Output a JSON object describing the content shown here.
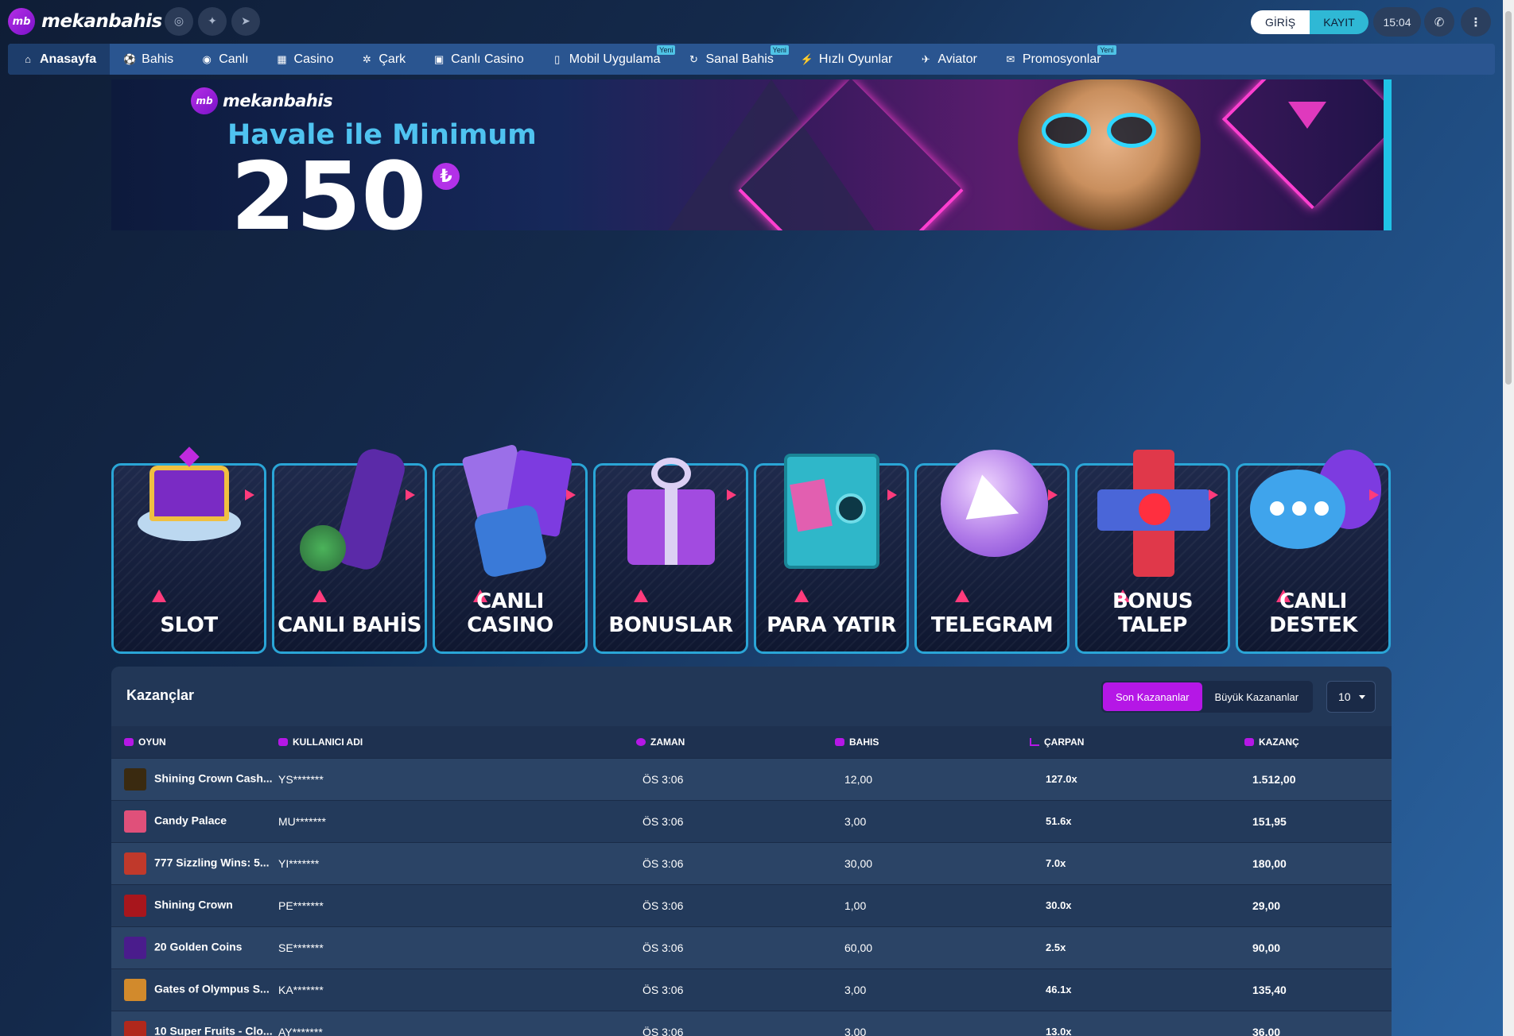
{
  "brand": {
    "logo_text": "mekanbahis",
    "logo_badge": "mb"
  },
  "header": {
    "social": [
      {
        "icon": "instagram-icon",
        "glyph": "◎"
      },
      {
        "icon": "twitter-icon",
        "glyph": "✦"
      },
      {
        "icon": "telegram-icon",
        "glyph": "➤"
      }
    ],
    "login_label": "GİRİŞ",
    "register_label": "KAYIT",
    "time": "15:04"
  },
  "nav": [
    {
      "label": "Anasayfa",
      "icon": "home-icon",
      "glyph": "⌂",
      "active": true
    },
    {
      "label": "Bahis",
      "icon": "soccer-ball-icon",
      "glyph": "⚽"
    },
    {
      "label": "Canlı",
      "icon": "live-icon",
      "glyph": "◉"
    },
    {
      "label": "Casino",
      "icon": "casino-icon",
      "glyph": "▦"
    },
    {
      "label": "Çark",
      "icon": "wheel-icon",
      "glyph": "✲"
    },
    {
      "label": "Canlı Casino",
      "icon": "live-casino-icon",
      "glyph": "▣"
    },
    {
      "label": "Mobil Uygulama",
      "icon": "mobile-icon",
      "glyph": "▯",
      "badge": "Yeni"
    },
    {
      "label": "Sanal Bahis",
      "icon": "virtual-icon",
      "glyph": "↻",
      "badge": "Yeni"
    },
    {
      "label": "Hızlı Oyunlar",
      "icon": "fast-games-icon",
      "glyph": "⚡"
    },
    {
      "label": "Aviator",
      "icon": "rocket-icon",
      "glyph": "✈"
    },
    {
      "label": "Promosyonlar",
      "icon": "gift-icon",
      "glyph": "✉",
      "badge": "Yeni"
    }
  ],
  "banner": {
    "logo_text": "mekanbahis",
    "headline": "Havale ile Minimum",
    "amount": "250",
    "currency_symbol": "₺"
  },
  "tiles": [
    {
      "label": "SLOT",
      "icon": "crown-icon"
    },
    {
      "label": "CANLI BAHİS",
      "icon": "football-player-icon"
    },
    {
      "label": "CANLI CASINO",
      "icon": "cards-dice-icon"
    },
    {
      "label": "BONUSLAR",
      "icon": "gift-box-icon"
    },
    {
      "label": "PARA YATIR",
      "icon": "safe-icon"
    },
    {
      "label": "TELEGRAM",
      "icon": "telegram-icon"
    },
    {
      "label": "BONUS TALEP",
      "icon": "bonus-cross-icon"
    },
    {
      "label": "CANLI DESTEK",
      "icon": "chat-bubbles-icon"
    }
  ],
  "winners": {
    "title": "Kazançlar",
    "tab_recent": "Son Kazananlar",
    "tab_big": "Büyük Kazananlar",
    "page_size": "10",
    "columns": [
      "OYUN",
      "KULLANICI ADI",
      "ZAMAN",
      "BAHIS",
      "ÇARPAN",
      "KAZANÇ"
    ],
    "rows": [
      {
        "game": "Shining Crown Cash...",
        "user": "YS*******",
        "time": "ÖS 3:06",
        "bet": "12,00",
        "mult": "127.0x",
        "win": "1.512,00",
        "thumb": "#3a2a10"
      },
      {
        "game": "Candy Palace",
        "user": "MU*******",
        "time": "ÖS 3:06",
        "bet": "3,00",
        "mult": "51.6x",
        "win": "151,95",
        "thumb": "#e0507a"
      },
      {
        "game": "777 Sizzling Wins: 5...",
        "user": "YI*******",
        "time": "ÖS 3:06",
        "bet": "30,00",
        "mult": "7.0x",
        "win": "180,00",
        "thumb": "#c0392b"
      },
      {
        "game": "Shining Crown",
        "user": "PE*******",
        "time": "ÖS 3:06",
        "bet": "1,00",
        "mult": "30.0x",
        "win": "29,00",
        "thumb": "#a8161c"
      },
      {
        "game": "20 Golden Coins",
        "user": "SE*******",
        "time": "ÖS 3:06",
        "bet": "60,00",
        "mult": "2.5x",
        "win": "90,00",
        "thumb": "#4a1c8c"
      },
      {
        "game": "Gates of Olympus S...",
        "user": "KA*******",
        "time": "ÖS 3:06",
        "bet": "3,00",
        "mult": "46.1x",
        "win": "135,40",
        "thumb": "#d28a2c"
      },
      {
        "game": "10 Super Fruits - Clo...",
        "user": "AY*******",
        "time": "ÖS 3:06",
        "bet": "3,00",
        "mult": "13.0x",
        "win": "36,00",
        "thumb": "#b0281c"
      }
    ]
  },
  "colors": {
    "accent_purple": "#b517e6",
    "accent_cyan": "#2fb8d5",
    "nav_bg": "#2a5590",
    "panel_bg": "#223757"
  }
}
